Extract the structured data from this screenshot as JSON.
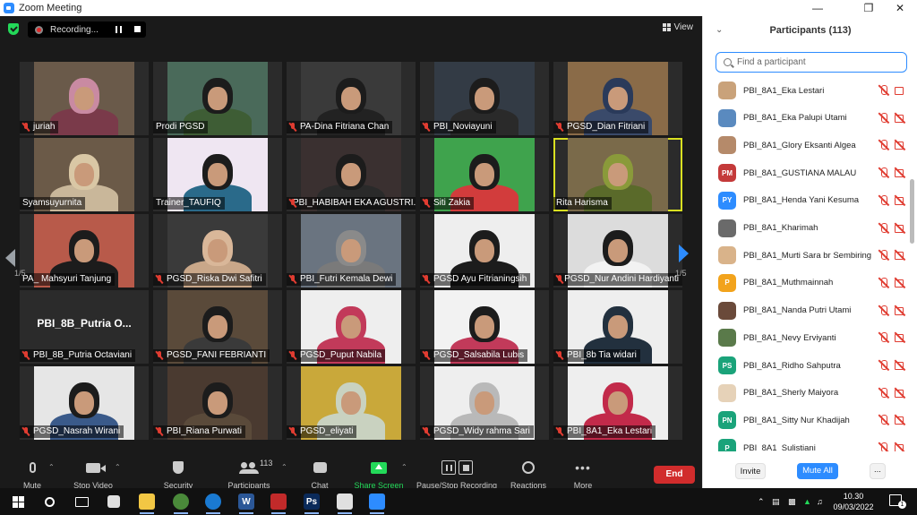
{
  "window": {
    "title": "Zoom Meeting"
  },
  "topbar": {
    "recording_label": "Recording...",
    "view_label": "View"
  },
  "gallery": {
    "page_left": "1/5",
    "page_right": "1/5",
    "tiles": [
      {
        "name": "juriah",
        "muted": true,
        "bg": "#6a5a4a",
        "hair": "#c98aa2",
        "shirt": "#7a3a4a"
      },
      {
        "name": "Prodi PGSD",
        "muted": false,
        "bg": "#4a6a5a",
        "hair": "#1c1c1c",
        "shirt": "#3e5d35"
      },
      {
        "name": "PA-Dina Fitriana Chan",
        "muted": true,
        "bg": "#3a3a3a",
        "hair": "#1c1c1c",
        "shirt": "#222222"
      },
      {
        "name": "PBI_Noviayuni",
        "muted": true,
        "bg": "#333b45",
        "hair": "#1c1c1c",
        "shirt": "#2a2a2a"
      },
      {
        "name": "PGSD_Dian Fitriani",
        "muted": true,
        "bg": "#8a6b48",
        "hair": "#2a3a5a",
        "shirt": "#3a4a6a"
      },
      {
        "name": "Syamsuyurnita",
        "muted": false,
        "bg": "#6b5a48",
        "hair": "#d9c7a5",
        "shirt": "#c9b79a"
      },
      {
        "name": "Trainer_TAUFIQ",
        "muted": false,
        "bg": "#efe6f2",
        "hair": "#1c1c1c",
        "shirt": "#2a6a8a"
      },
      {
        "name": "PBI_HABIBAH EKA AGUSTRI...",
        "muted": true,
        "bg": "#3a3030",
        "hair": "#1c1c1c",
        "shirt": "#2a2a2a"
      },
      {
        "name": "Siti Zakia",
        "muted": true,
        "bg": "#3fa34d",
        "hair": "#1c1c1c",
        "shirt": "#d23c3c"
      },
      {
        "name": "Rita Harisma",
        "muted": false,
        "bg": "#7a6a4a",
        "hair": "#8a9a3a",
        "shirt": "#5a6a2a"
      },
      {
        "name": "PA_ Mahsyuri Tanjung",
        "muted": false,
        "bg": "#b85a4a",
        "hair": "#1c1c1c",
        "shirt": "#1c1c1c"
      },
      {
        "name": "PGSD_Riska Dwi Safitri",
        "muted": true,
        "bg": "#3a3a3a",
        "hair": "#d9b799",
        "shirt": "#c9a789"
      },
      {
        "name": "PBI_Futri Kemala Dewi",
        "muted": true,
        "bg": "#6a7480",
        "hair": "#8a8a8a",
        "shirt": "#7a7a7a"
      },
      {
        "name": "PGSD Ayu Fitrianingsih",
        "muted": true,
        "bg": "#eeeeee",
        "hair": "#1c1c1c",
        "shirt": "#1c1c1c"
      },
      {
        "name": "PGSD_Nur Andini Hardiyanti",
        "muted": true,
        "bg": "#dcdcdc",
        "hair": "#1c1c1c",
        "shirt": "#f2f2f2"
      },
      {
        "name": "PBI_8B_Putria Octaviani",
        "muted": true,
        "bg": "#2b2b2b",
        "hair": "",
        "shirt": "",
        "label_only": "PBI_8B_Putria  O..."
      },
      {
        "name": "PGSD_FANI FEBRIANTI",
        "muted": true,
        "bg": "#5a4a3a",
        "hair": "#1c1c1c",
        "shirt": "#3a3a3a"
      },
      {
        "name": "PGSD_Puput Nabila",
        "muted": true,
        "bg": "#eeeeee",
        "hair": "#c23a5a",
        "shirt": "#c23a5a"
      },
      {
        "name": "PGSD_Salsabila Lubis",
        "muted": true,
        "bg": "#f2f2f2",
        "hair": "#1c1c1c",
        "shirt": "#c23a5a"
      },
      {
        "name": "PBI_8b Tia widari",
        "muted": true,
        "bg": "#eeeeee",
        "hair": "#22303e",
        "shirt": "#22303e"
      },
      {
        "name": "PGSD_Nasrah Wirani",
        "muted": true,
        "bg": "#e6e6e6",
        "hair": "#1c1c1c",
        "shirt": "#3a5a8a"
      },
      {
        "name": "PBI_Riana Purwati",
        "muted": true,
        "bg": "#4a3a30",
        "hair": "#1c1c1c",
        "shirt": "#5a4a3a"
      },
      {
        "name": "PGSD_eliyati",
        "muted": true,
        "bg": "#c9a83a",
        "hair": "#c9d2c0",
        "shirt": "#c9d2c0"
      },
      {
        "name": "PGSD_Widy rahma Sari",
        "muted": true,
        "bg": "#eeeeee",
        "hair": "#b9b9b9",
        "shirt": "#b9b9b9"
      },
      {
        "name": "PBI_8A1_Eka Lestari",
        "muted": true,
        "bg": "#eeeeee",
        "hair": "#c22a4a",
        "shirt": "#c22a4a"
      }
    ]
  },
  "toolbar": {
    "mute": "Mute",
    "stop_video": "Stop Video",
    "security": "Security",
    "participants": "Participants",
    "participants_count": "113",
    "chat": "Chat",
    "share_screen": "Share Screen",
    "pause_stop_recording": "Pause/Stop Recording",
    "reactions": "Reactions",
    "more": "More",
    "end": "End"
  },
  "panel": {
    "title": "Participants (113)",
    "search_placeholder": "Find a participant",
    "participants": [
      {
        "name": "PBI_8A1_Eka Lestari",
        "avatar_initials": "",
        "avatar_color": "#c9a27a",
        "video": true
      },
      {
        "name": "PBI_8A1_Eka Palupi Utami",
        "avatar_initials": "",
        "avatar_color": "#5a8abf",
        "video": false
      },
      {
        "name": "PBI_8A1_Glory Eksanti Algea",
        "avatar_initials": "",
        "avatar_color": "#b58a6a",
        "video": false
      },
      {
        "name": "PBI_8A1_GUSTIANA MALAU",
        "avatar_initials": "PM",
        "avatar_color": "#c43a3a",
        "video": false
      },
      {
        "name": "PBI_8A1_Henda Yani Kesuma",
        "avatar_initials": "PY",
        "avatar_color": "#2d8cff",
        "video": false
      },
      {
        "name": "PBI_8A1_Kharimah",
        "avatar_initials": "",
        "avatar_color": "#6a6a6a",
        "video": false
      },
      {
        "name": "PBI_8A1_Murti Sara br Sembiring",
        "avatar_initials": "",
        "avatar_color": "#d9b38a",
        "video": false
      },
      {
        "name": "PBI_8A1_Muthmainnah",
        "avatar_initials": "P",
        "avatar_color": "#f2a31c",
        "video": false
      },
      {
        "name": "PBI_8A1_Nanda Putri Utami",
        "avatar_initials": "",
        "avatar_color": "#6a4a3a",
        "video": false
      },
      {
        "name": "PBI_8A1_Nevy Erviyanti",
        "avatar_initials": "",
        "avatar_color": "#5a7a4a",
        "video": false
      },
      {
        "name": "PBI_8A1_Ridho Sahputra",
        "avatar_initials": "PS",
        "avatar_color": "#1aa37a",
        "video": false
      },
      {
        "name": "PBI_8A1_Sherly Maiyora",
        "avatar_initials": "",
        "avatar_color": "#e6d2b8",
        "video": false
      },
      {
        "name": "PBI_8A1_Sitty Nur Khadijah",
        "avatar_initials": "PN",
        "avatar_color": "#1aa37a",
        "video": false
      },
      {
        "name": "PBI_8A1_Sulistiani",
        "avatar_initials": "P",
        "avatar_color": "#1aa37a",
        "video": false
      }
    ],
    "footer": {
      "invite": "Invite",
      "mute_all": "Mute All",
      "more": "..."
    }
  },
  "taskbar": {
    "apps": [
      {
        "name": "file-explorer",
        "color": "#f2c744",
        "label": ""
      },
      {
        "name": "chrome",
        "color": "#4a8a3a",
        "label": ""
      },
      {
        "name": "edge",
        "color": "#1a7ad2",
        "label": ""
      },
      {
        "name": "word",
        "color": "#2b5797",
        "label": "W"
      },
      {
        "name": "app-red",
        "color": "#c22a2a",
        "label": ""
      },
      {
        "name": "photoshop",
        "color": "#0a2a5a",
        "label": "Ps"
      },
      {
        "name": "photos",
        "color": "#e0e0e0",
        "label": ""
      },
      {
        "name": "zoom",
        "color": "#2d8cff",
        "label": ""
      }
    ],
    "time": "10.30",
    "date": "09/03/2022",
    "notifications": "1"
  }
}
